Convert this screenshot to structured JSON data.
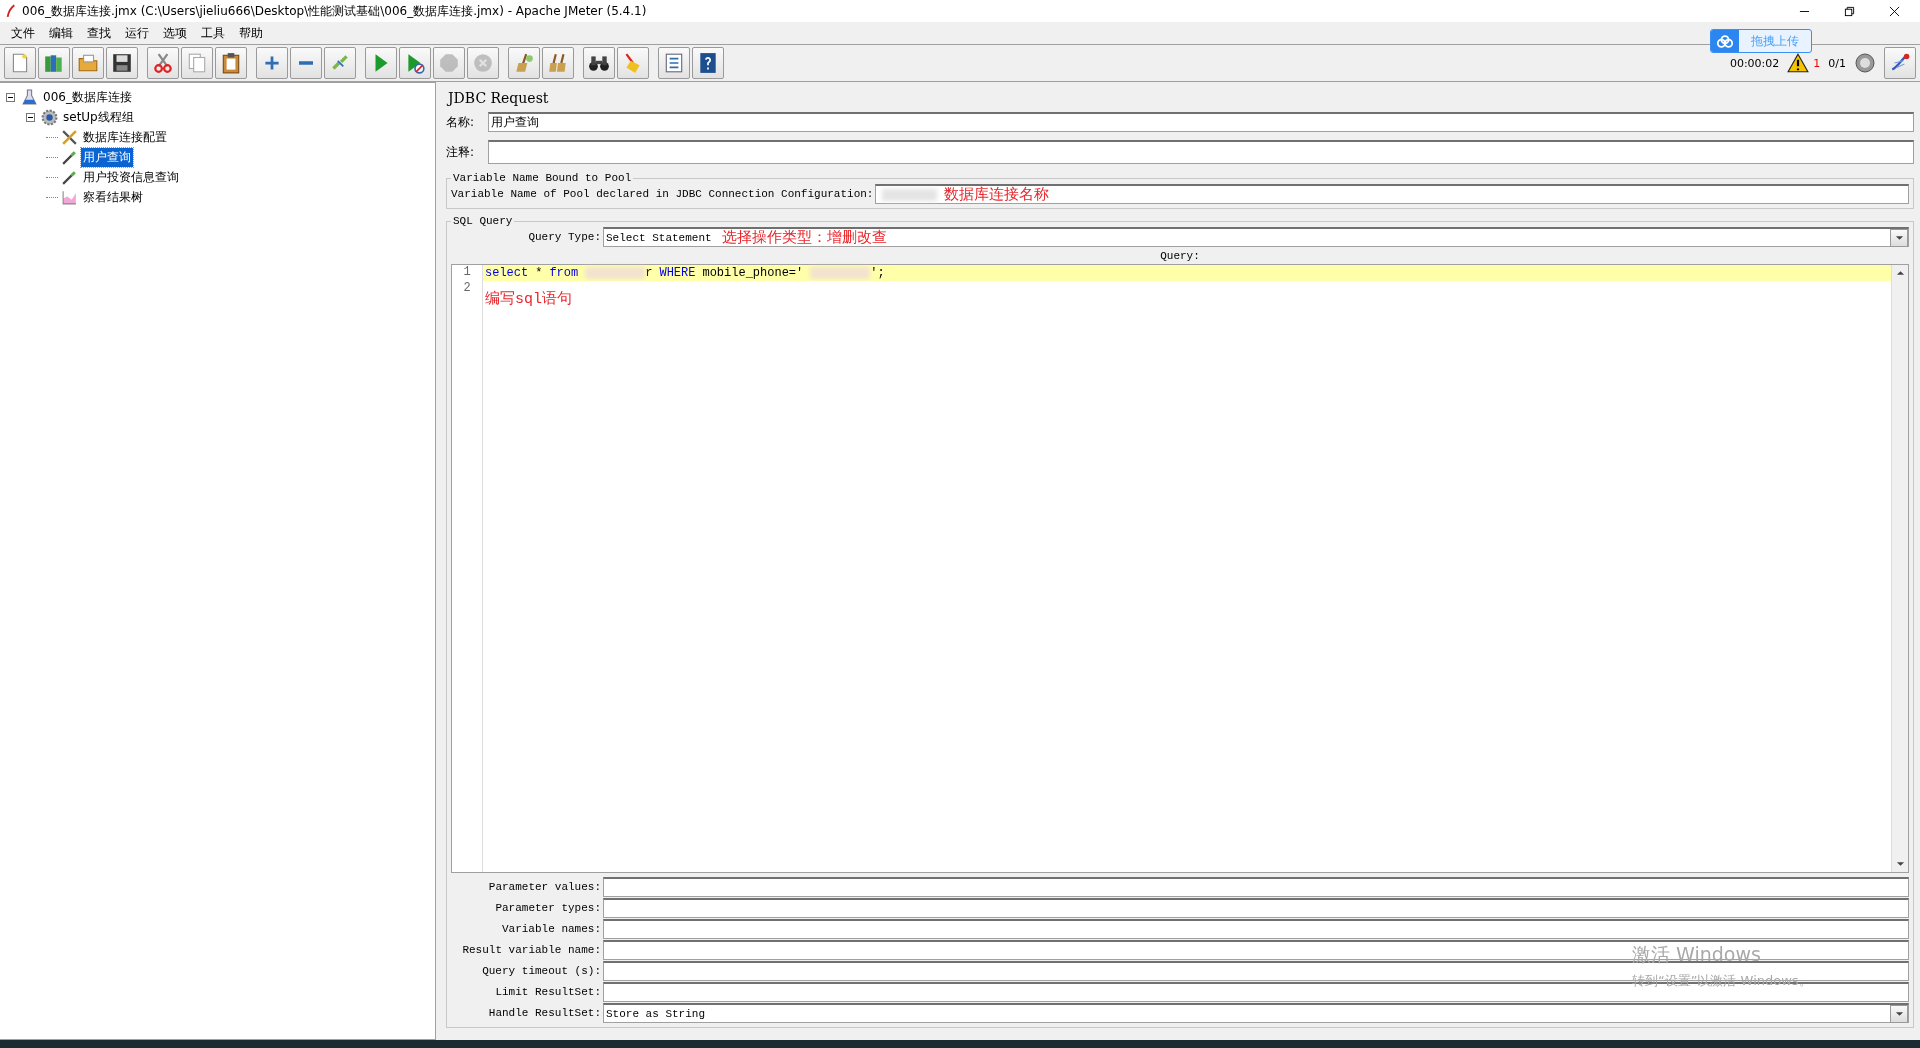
{
  "window": {
    "title": "006_数据库连接.jmx (C:\\Users\\jieliu666\\Desktop\\性能测试基础\\006_数据库连接.jmx) - Apache JMeter (5.4.1)"
  },
  "menu": [
    "文件",
    "编辑",
    "查找",
    "运行",
    "选项",
    "工具",
    "帮助"
  ],
  "toolbar": [
    {
      "kind": "new",
      "disabled": false
    },
    {
      "kind": "templates",
      "disabled": false
    },
    {
      "kind": "open",
      "disabled": false
    },
    {
      "kind": "save",
      "disabled": false
    },
    {
      "kind": "separator"
    },
    {
      "kind": "cut",
      "disabled": false
    },
    {
      "kind": "copy",
      "disabled": false
    },
    {
      "kind": "paste",
      "disabled": false
    },
    {
      "kind": "separator"
    },
    {
      "kind": "expand",
      "disabled": false
    },
    {
      "kind": "collapse",
      "disabled": false
    },
    {
      "kind": "toggle",
      "disabled": false
    },
    {
      "kind": "separator"
    },
    {
      "kind": "start",
      "disabled": false
    },
    {
      "kind": "start-no-pause",
      "disabled": false
    },
    {
      "kind": "stop",
      "disabled": true
    },
    {
      "kind": "shutdown",
      "disabled": true
    },
    {
      "kind": "separator"
    },
    {
      "kind": "clear",
      "disabled": false
    },
    {
      "kind": "clear-all",
      "disabled": false
    },
    {
      "kind": "separator"
    },
    {
      "kind": "search",
      "disabled": false
    },
    {
      "kind": "reset-search",
      "disabled": false
    },
    {
      "kind": "separator"
    },
    {
      "kind": "functions",
      "disabled": false
    },
    {
      "kind": "help",
      "disabled": false
    }
  ],
  "upload_button": {
    "label": "拖拽上传"
  },
  "status": {
    "elapsed": "00:00:02",
    "errors": "1",
    "threads": "0/1"
  },
  "tree": [
    {
      "label": "006_数据库连接",
      "kind": "plan",
      "expanded": true,
      "selected": false,
      "children": [
        {
          "label": "setUp线程组",
          "kind": "threadgroup",
          "expanded": true,
          "selected": false,
          "children": [
            {
              "label": "数据库连接配置",
              "kind": "config",
              "selected": false
            },
            {
              "label": "用户查询",
              "kind": "sampler",
              "selected": true
            },
            {
              "label": "用户投资信息查询",
              "kind": "sampler",
              "selected": false
            },
            {
              "label": "察看结果树",
              "kind": "listener",
              "selected": false
            }
          ]
        }
      ]
    }
  ],
  "panel": {
    "title": "JDBC Request",
    "name_label": "名称:",
    "name_value": "用户查询",
    "comment_label": "注释:"
  },
  "pool": {
    "legend": "Variable Name Bound to Pool",
    "label": "Variable Name of Pool declared in JDBC Connection Configuration:",
    "redacted": true,
    "annotation": "数据库连接名称"
  },
  "sql": {
    "legend": "SQL Query",
    "query_type_label": "Query Type:",
    "query_type": "Select Statement",
    "type_annotation": "选择操作类型：增删改查",
    "query_label": "Query:",
    "lines": [
      {
        "number": "1",
        "current": true,
        "tokens": [
          {
            "kind": "keyword",
            "text": "select"
          },
          {
            "kind": "plain",
            "text": "*"
          },
          {
            "kind": "keyword",
            "text": "from"
          },
          {
            "kind": "redacted"
          },
          {
            "kind": "plain",
            "text": "r"
          },
          {
            "kind": "keyword",
            "text": "WHERE"
          },
          {
            "kind": "plain",
            "text": "mobile_phone='"
          },
          {
            "kind": "redacted"
          },
          {
            "kind": "plain",
            "text": "';"
          }
        ]
      },
      {
        "number": "2",
        "current": false
      }
    ],
    "editor_annotation": "编写sql语句"
  },
  "params": [
    {
      "label": "Parameter values:",
      "kind": "text"
    },
    {
      "label": "Parameter types:",
      "kind": "text"
    },
    {
      "label": "Variable names:",
      "kind": "text"
    },
    {
      "label": "Result variable name:",
      "kind": "text"
    },
    {
      "label": "Query timeout (s):",
      "kind": "text"
    },
    {
      "label": "Limit ResultSet:",
      "kind": "text"
    },
    {
      "label": "Handle ResultSet:",
      "kind": "select",
      "value": "Store as String"
    }
  ],
  "os_notice": [
    "激活 Windows",
    "转到“设置”以激活 Windows。"
  ]
}
